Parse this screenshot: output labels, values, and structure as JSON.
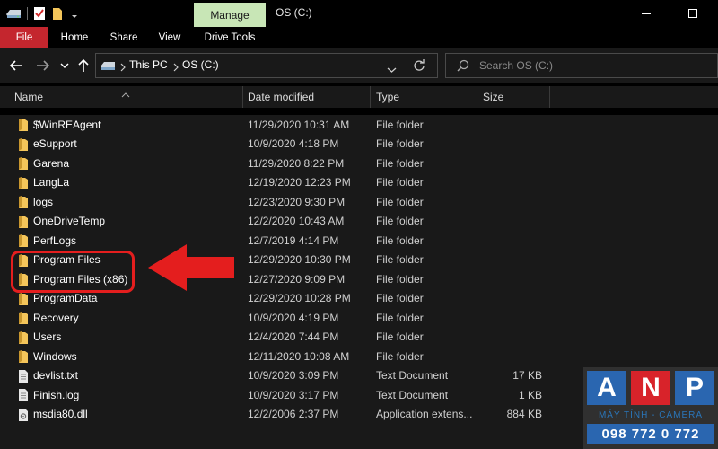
{
  "titlebar": {
    "manage_tab": "Manage",
    "window_title": "OS (C:)"
  },
  "ribbon": {
    "tabs": [
      "File",
      "Home",
      "Share",
      "View",
      "Drive Tools"
    ]
  },
  "address": {
    "crumbs": [
      "This PC",
      "OS (C:)"
    ],
    "search_placeholder": "Search OS (C:)"
  },
  "columns": {
    "name": "Name",
    "date": "Date modified",
    "type": "Type",
    "size": "Size"
  },
  "files": [
    {
      "name": "$WinREAgent",
      "date": "11/29/2020 10:31 AM",
      "type": "File folder",
      "size": "",
      "icon": "folder-icon"
    },
    {
      "name": "eSupport",
      "date": "10/9/2020 4:18 PM",
      "type": "File folder",
      "size": "",
      "icon": "folder-icon"
    },
    {
      "name": "Garena",
      "date": "11/29/2020 8:22 PM",
      "type": "File folder",
      "size": "",
      "icon": "folder-icon"
    },
    {
      "name": "LangLa",
      "date": "12/19/2020 12:23 PM",
      "type": "File folder",
      "size": "",
      "icon": "folder-icon"
    },
    {
      "name": "logs",
      "date": "12/23/2020 9:30 PM",
      "type": "File folder",
      "size": "",
      "icon": "folder-icon"
    },
    {
      "name": "OneDriveTemp",
      "date": "12/2/2020 10:43 AM",
      "type": "File folder",
      "size": "",
      "icon": "folder-icon"
    },
    {
      "name": "PerfLogs",
      "date": "12/7/2019 4:14 PM",
      "type": "File folder",
      "size": "",
      "icon": "folder-icon"
    },
    {
      "name": "Program Files",
      "date": "12/29/2020 10:30 PM",
      "type": "File folder",
      "size": "",
      "icon": "folder-icon"
    },
    {
      "name": "Program Files (x86)",
      "date": "12/27/2020 9:09 PM",
      "type": "File folder",
      "size": "",
      "icon": "folder-icon"
    },
    {
      "name": "ProgramData",
      "date": "12/29/2020 10:28 PM",
      "type": "File folder",
      "size": "",
      "icon": "folder-icon"
    },
    {
      "name": "Recovery",
      "date": "10/9/2020 4:19 PM",
      "type": "File folder",
      "size": "",
      "icon": "folder-icon"
    },
    {
      "name": "Users",
      "date": "12/4/2020 7:44 PM",
      "type": "File folder",
      "size": "",
      "icon": "folder-icon"
    },
    {
      "name": "Windows",
      "date": "12/11/2020 10:08 AM",
      "type": "File folder",
      "size": "",
      "icon": "folder-icon"
    },
    {
      "name": "devlist.txt",
      "date": "10/9/2020 3:09 PM",
      "type": "Text Document",
      "size": "17 KB",
      "icon": "text-file-icon"
    },
    {
      "name": "Finish.log",
      "date": "10/9/2020 3:17 PM",
      "type": "Text Document",
      "size": "1 KB",
      "icon": "text-file-icon"
    },
    {
      "name": "msdia80.dll",
      "date": "12/2/2006 2:37 PM",
      "type": "Application extens...",
      "size": "884 KB",
      "icon": "dll-file-icon"
    }
  ],
  "watermark": {
    "letters": [
      "A",
      "N",
      "P"
    ],
    "subtitle": "MÁY TÍNH - CAMERA",
    "phone": "098 772 0 772"
  },
  "colors": {
    "file_tab": "#c4262e",
    "manage_tab": "#c8e6b6",
    "highlight": "#e41e1e",
    "folder": "#f4c55a",
    "logo_blue": "#2a66b0",
    "logo_red": "#d8232a"
  }
}
